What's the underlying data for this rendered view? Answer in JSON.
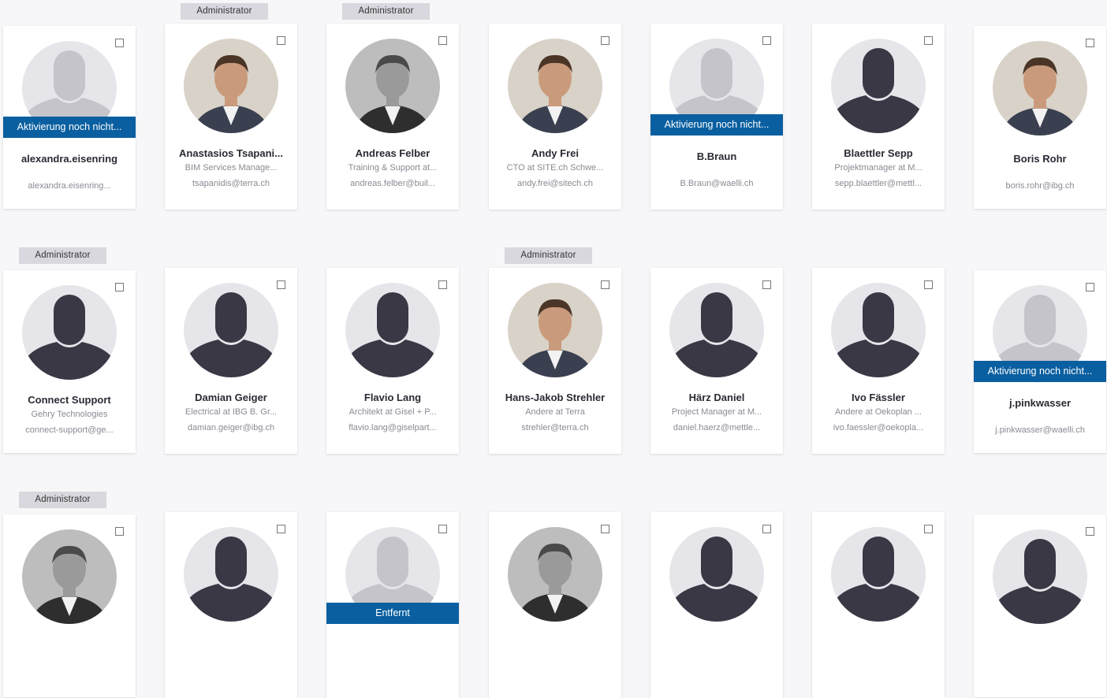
{
  "rows": [
    {
      "members": [
        {
          "name": "alexandra.eisenring",
          "subtitle": "",
          "email": "alexandra.eisenring...",
          "status": "Aktivierung noch nicht...",
          "admin": "",
          "avatar": "placeholder-pending"
        },
        {
          "name": "Anastasios Tsapani...",
          "subtitle": "BIM Services Manage...",
          "email": "tsapanidis@terra.ch",
          "status": "",
          "admin": "Administrator",
          "avatar": "photo"
        },
        {
          "name": "Andreas Felber",
          "subtitle": "Training & Support at...",
          "email": "andreas.felber@buil...",
          "status": "",
          "admin": "Administrator",
          "avatar": "photo-bw"
        },
        {
          "name": "Andy Frei",
          "subtitle": "CTO at SITE.ch Schwe...",
          "email": "andy.frei@sitech.ch",
          "status": "",
          "admin": "",
          "avatar": "photo"
        },
        {
          "name": "B.Braun",
          "subtitle": "",
          "email": "B.Braun@waelli.ch",
          "status": "Aktivierung noch nicht...",
          "admin": "",
          "avatar": "placeholder-pending"
        },
        {
          "name": "Blaettler Sepp",
          "subtitle": "Projektmanager at M...",
          "email": "sepp.blaettler@mettl...",
          "status": "",
          "admin": "",
          "avatar": "placeholder"
        },
        {
          "name": "Boris Rohr",
          "subtitle": "",
          "email": "boris.rohr@ibg.ch",
          "status": "",
          "admin": "",
          "avatar": "photo"
        }
      ]
    },
    {
      "members": [
        {
          "name": "Connect Support",
          "subtitle": "Gehry Technologies",
          "email": "connect-support@ge...",
          "status": "",
          "admin": "Administrator",
          "avatar": "placeholder"
        },
        {
          "name": "Damian Geiger",
          "subtitle": "Electrical at IBG B. Gr...",
          "email": "damian.geiger@ibg.ch",
          "status": "",
          "admin": "",
          "avatar": "placeholder"
        },
        {
          "name": "Flavio Lang",
          "subtitle": "Architekt at Gisel + P...",
          "email": "flavio.lang@giselpart...",
          "status": "",
          "admin": "",
          "avatar": "placeholder"
        },
        {
          "name": "Hans-Jakob Strehler",
          "subtitle": "Andere at Terra",
          "email": "strehler@terra.ch",
          "status": "",
          "admin": "Administrator",
          "avatar": "photo"
        },
        {
          "name": "Härz Daniel",
          "subtitle": "Project Manager at M...",
          "email": "daniel.haerz@mettle...",
          "status": "",
          "admin": "",
          "avatar": "placeholder"
        },
        {
          "name": "Ivo Fässler",
          "subtitle": "Andere at Oekoplan ...",
          "email": "ivo.faessler@oekopla...",
          "status": "",
          "admin": "",
          "avatar": "placeholder"
        },
        {
          "name": "j.pinkwasser",
          "subtitle": "",
          "email": "j.pinkwasser@waelli.ch",
          "status": "Aktivierung noch nicht...",
          "admin": "",
          "avatar": "placeholder-pending"
        }
      ]
    },
    {
      "members": [
        {
          "name": "",
          "subtitle": "",
          "email": "",
          "status": "",
          "admin": "Administrator",
          "avatar": "photo-bw"
        },
        {
          "name": "",
          "subtitle": "",
          "email": "",
          "status": "",
          "admin": "",
          "avatar": "placeholder"
        },
        {
          "name": "",
          "subtitle": "",
          "email": "",
          "status": "Entfernt",
          "admin": "",
          "avatar": "placeholder-pending"
        },
        {
          "name": "",
          "subtitle": "",
          "email": "",
          "status": "",
          "admin": "",
          "avatar": "photo-bw"
        },
        {
          "name": "",
          "subtitle": "",
          "email": "",
          "status": "",
          "admin": "",
          "avatar": "placeholder"
        },
        {
          "name": "",
          "subtitle": "",
          "email": "",
          "status": "",
          "admin": "",
          "avatar": "placeholder"
        },
        {
          "name": "",
          "subtitle": "",
          "email": "",
          "status": "",
          "admin": "",
          "avatar": "placeholder"
        }
      ]
    }
  ],
  "colors": {
    "status_bar": "#0a5fa0",
    "admin_tag": "#d8d8de",
    "placeholder_silhouette": "#3a3845",
    "placeholder_pending_silhouette": "#c4c4ca",
    "avatar_background": "#e6e6ea"
  }
}
